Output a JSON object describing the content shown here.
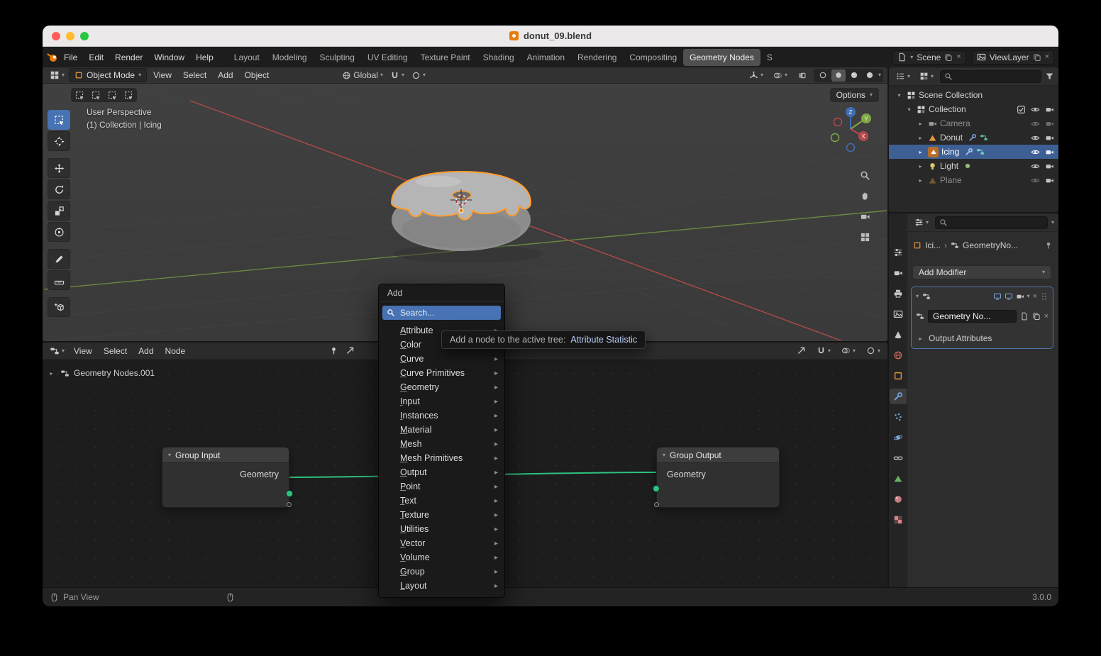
{
  "window": {
    "title": "donut_09.blend"
  },
  "topbar": {
    "menus": [
      "File",
      "Edit",
      "Render",
      "Window",
      "Help"
    ],
    "workspaces": [
      "Layout",
      "Modeling",
      "Sculpting",
      "UV Editing",
      "Texture Paint",
      "Shading",
      "Animation",
      "Rendering",
      "Compositing",
      "Geometry Nodes",
      "S"
    ],
    "active_workspace": "Geometry Nodes",
    "scene": "Scene",
    "view_layer": "ViewLayer"
  },
  "viewport": {
    "mode": "Object Mode",
    "menus": [
      "View",
      "Select",
      "Add",
      "Object"
    ],
    "orientation": "Global",
    "options": "Options",
    "overlay": {
      "line1": "User Perspective",
      "line2": "(1) Collection | Icing"
    }
  },
  "outliner": {
    "root": "Scene Collection",
    "items": [
      {
        "label": "Collection"
      },
      {
        "label": "Camera"
      },
      {
        "label": "Donut"
      },
      {
        "label": "Icing"
      },
      {
        "label": "Light"
      },
      {
        "label": "Plane"
      }
    ]
  },
  "properties": {
    "breadcrumb": {
      "object": "Ici...",
      "modifier": "GeometryNo..."
    },
    "add_modifier": "Add Modifier",
    "modifier_name": "Geometry No...",
    "panel_output_attributes": "Output Attributes"
  },
  "node_editor": {
    "menus": [
      "View",
      "Select",
      "Add",
      "Node"
    ],
    "breadcrumb": "Geometry Nodes.001",
    "group_input": {
      "title": "Group Input",
      "socket": "Geometry"
    },
    "group_output": {
      "title": "Group Output",
      "socket": "Geometry"
    }
  },
  "add_menu": {
    "title": "Add",
    "search_placeholder": "Search...",
    "items": [
      {
        "label": "Attribute"
      },
      {
        "label": "Color"
      },
      {
        "label": "Curve"
      },
      {
        "label": "Curve Primitives"
      },
      {
        "label": "Geometry"
      },
      {
        "label": "Input"
      },
      {
        "label": "Instances"
      },
      {
        "label": "Material"
      },
      {
        "label": "Mesh"
      },
      {
        "label": "Mesh Primitives"
      },
      {
        "label": "Output"
      },
      {
        "label": "Point"
      },
      {
        "label": "Text"
      },
      {
        "label": "Texture"
      },
      {
        "label": "Utilities"
      },
      {
        "label": "Vector"
      },
      {
        "label": "Volume"
      },
      {
        "label": "Group"
      },
      {
        "label": "Layout"
      }
    ]
  },
  "tooltip": {
    "text": "Add a node to the active tree:",
    "highlight": "Attribute Statistic"
  },
  "statusbar": {
    "left": "Pan View",
    "version": "3.0.0"
  },
  "colors": {
    "accent": "#4772b3",
    "selection": "#3d5f94",
    "wire": "#2ec27e",
    "icing_outline": "#ff9d2e",
    "mesh_icon": "#e8973c"
  }
}
